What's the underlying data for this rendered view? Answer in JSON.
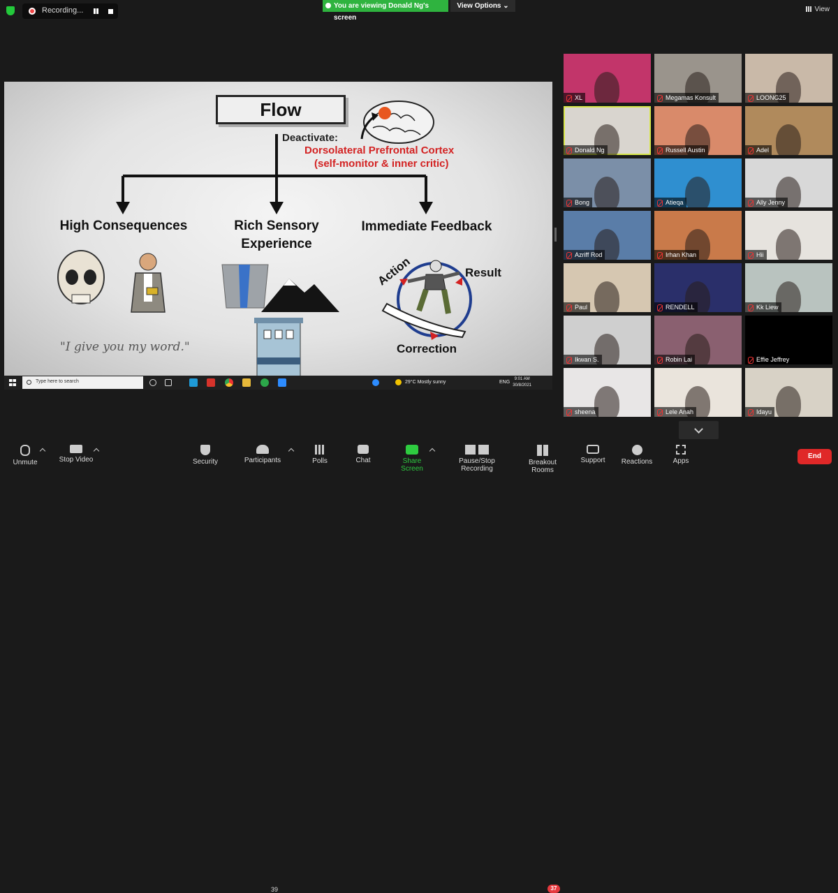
{
  "recording": {
    "label": "Recording..."
  },
  "banner": {
    "viewing": "You are viewing Donald Ng's screen",
    "options": "View Options"
  },
  "view": {
    "label": "View"
  },
  "slide": {
    "title": "Flow",
    "deactivate": "Deactivate:",
    "region": "Dorsolateral Prefrontal Cortex",
    "region_note": "(self-monitor & inner critic)",
    "col1": "High Consequences",
    "col2_line1": "Rich Sensory",
    "col2_line2": "Experience",
    "col3": "Immediate Feedback",
    "quote": "\"I give you my word.\"",
    "action": "Action",
    "result": "Result",
    "correction": "Correction"
  },
  "taskbar": {
    "search_placeholder": "Type here to search",
    "weather": "29°C  Mostly sunny",
    "lang": "ENG",
    "time": "9:01 AM",
    "date": "30/8/2021"
  },
  "participants": [
    {
      "name": "XL",
      "color": "#c2356a"
    },
    {
      "name": "Megamas Konsult",
      "color": "#9a948c"
    },
    {
      "name": "LOONG25",
      "color": "#c9b9a8"
    },
    {
      "name": "Donald Ng",
      "color": "#d9d5cf"
    },
    {
      "name": "Russell Austin",
      "color": "#d98a6a"
    },
    {
      "name": "Adel",
      "color": "#b08a5c"
    },
    {
      "name": "Bong",
      "color": "#7b8fa8"
    },
    {
      "name": "Atieqa",
      "color": "#2f8fd0"
    },
    {
      "name": "Ally Jenny",
      "color": "#d8d8d8"
    },
    {
      "name": "Azriff Rod",
      "color": "#5a7da8"
    },
    {
      "name": "Irhan Khan",
      "color": "#c97a4a"
    },
    {
      "name": "Hii",
      "color": "#e6e3de"
    },
    {
      "name": "Paul",
      "color": "#d6c7b1"
    },
    {
      "name": "RENDELL",
      "color": "#2a2f6a"
    },
    {
      "name": "Kk Liew",
      "color": "#b9c3bf"
    },
    {
      "name": "Ikwan S.",
      "color": "#cfcfcf"
    },
    {
      "name": "Robin Lai",
      "color": "#8a6070"
    },
    {
      "name": "Effie Jeffrey",
      "color": "#000000"
    },
    {
      "name": "sheena",
      "color": "#e8e6e6"
    },
    {
      "name": "Lele Anah",
      "color": "#eae4dc"
    },
    {
      "name": "Idayu",
      "color": "#d8d2c6"
    }
  ],
  "toolbar": {
    "unmute": "Unmute",
    "stop_video": "Stop Video",
    "security": "Security",
    "participants": "Participants",
    "participants_count": "39",
    "polls": "Polls",
    "chat": "Chat",
    "share_screen": "Share Screen",
    "recording": "Pause/Stop Recording",
    "breakout": "Breakout Rooms",
    "breakout_badge": "37",
    "support": "Support",
    "reactions": "Reactions",
    "apps": "Apps",
    "end": "End"
  }
}
